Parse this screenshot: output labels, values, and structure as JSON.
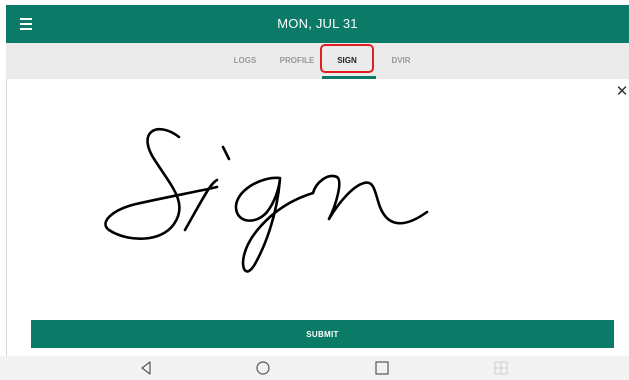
{
  "header": {
    "menu_icon": "hamburger-menu-icon",
    "title": "MON, JUL 31"
  },
  "tabs": [
    {
      "label": "LOGS",
      "active": false
    },
    {
      "label": "PROFILE",
      "active": false
    },
    {
      "label": "SIGN",
      "active": true
    },
    {
      "label": "DVIR",
      "active": false
    }
  ],
  "signature": {
    "close_icon": "close-icon",
    "close_glyph": "✕",
    "handwritten_text": "Sign"
  },
  "actions": {
    "submit_label": "SUBMIT"
  },
  "system_nav": {
    "buttons": [
      "back-icon",
      "home-icon",
      "recents-icon",
      "grid-icon"
    ]
  },
  "colors": {
    "brand": "#0b7a67",
    "tab_bar": "#ebebeb",
    "highlight": "#e02020"
  }
}
